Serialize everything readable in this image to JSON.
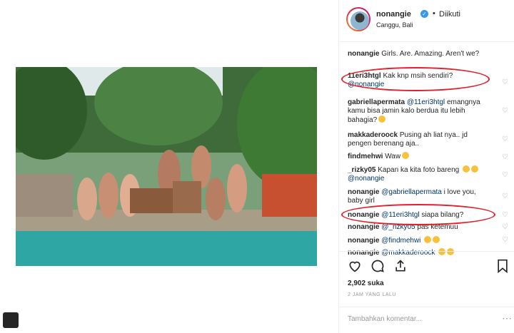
{
  "post": {
    "username": "nonangie",
    "follow_label": "Diikuti",
    "location": "Canggu, Bali",
    "likes": "2,902 suka",
    "timestamp": "2 JAM YANG LALU",
    "comment_placeholder": "Tambahkan komentar..."
  },
  "comments": [
    {
      "user": "nonangie",
      "text": "Girls. Are. Amazing. Aren't we?"
    },
    {
      "user": "11eri3htgl",
      "text": "Kak knp msih sendiri?",
      "mention": "@nonangie"
    },
    {
      "user": "gabriellapermata",
      "mention": "@11eri3htgl",
      "text": "emangnya kamu bisa jamin kalo berdua itu lebih bahagia?"
    },
    {
      "user": "makkaderoock",
      "text": "Pusing ah liat nya.. jd pengen berenang aja.."
    },
    {
      "user": "findmehwi",
      "text": "Waw"
    },
    {
      "user": "_rizky05",
      "text": "Kapan ka kita foto bareng",
      "mention": "@nonangie"
    },
    {
      "user": "nonangie",
      "mention": "@gabriellapermata",
      "text": "i love you, baby girl"
    },
    {
      "user": "nonangie",
      "mention": "@11eri3htgl",
      "text": "siapa bilang?"
    },
    {
      "user": "nonangie",
      "mention": "@_rizky05",
      "text": "pas ketemuu"
    },
    {
      "user": "nonangie",
      "mention": "@findmehwi",
      "text": ""
    },
    {
      "user": "nonangie",
      "mention": "@makkaderoock",
      "text": ""
    }
  ],
  "icons": {
    "like": "heart-icon",
    "comment": "comment-icon",
    "share": "share-icon",
    "save": "bookmark-icon",
    "more": "more-icon"
  }
}
